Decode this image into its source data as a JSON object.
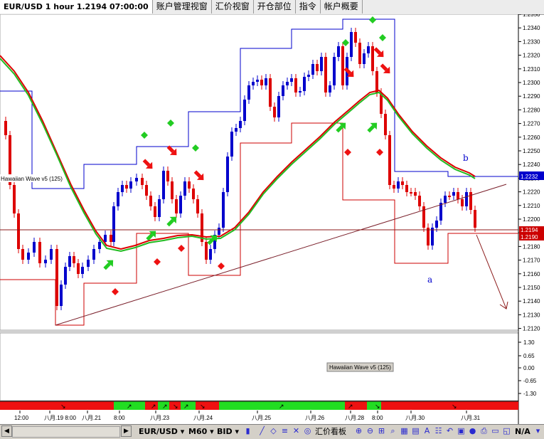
{
  "tabs": [
    {
      "label": "EUR/USD 1 hour 1.2194 07:00:00",
      "active": true
    },
    {
      "label": "账户管理视窗",
      "active": false
    },
    {
      "label": "汇价视窗",
      "active": false
    },
    {
      "label": "开仓部位",
      "active": false
    },
    {
      "label": "指令",
      "active": false
    },
    {
      "label": "帐户概要",
      "active": false
    }
  ],
  "chart": {
    "price_axis": [
      "1.2350",
      "1.2340",
      "1.2330",
      "1.2320",
      "1.2310",
      "1.2300",
      "1.2290",
      "1.2280",
      "1.2270",
      "1.2260",
      "1.2250",
      "1.2240",
      "1.2230",
      "1.2220",
      "1.2210",
      "1.2200",
      "1.2190",
      "1.2180",
      "1.2170",
      "1.2160",
      "1.2150",
      "1.2140",
      "1.2130",
      "1.2120"
    ],
    "current_price": "1.2194",
    "right_tag_upper": "1.2232",
    "right_tag_lower": "1.2190",
    "indicator_label": "Hawaiian Wave v5 (125)",
    "annotation_a": "a",
    "annotation_b": "b",
    "colors": {
      "up": "#0000cc",
      "down": "#dd0000",
      "ma_red": "#dd0000",
      "ma_green": "#22bb22",
      "band_blue": "#0000cc",
      "band_red": "#cc0000",
      "trend": "#7a1f2a"
    }
  },
  "indicator": {
    "label": "Hawaiian Wave v5 (125)",
    "axis": [
      "1.30",
      "0.65",
      "0.00",
      "-0.65",
      "-1.30"
    ]
  },
  "time_axis": [
    "12:00",
    "八月.19 8:00",
    "八月.21",
    "8:00",
    "八月.23",
    "八月.24",
    "八月.25",
    "八月.26",
    "八月.28",
    "8:00",
    "八月.30",
    "八月.31"
  ],
  "bottombar": {
    "symbol": "EUR/USD",
    "period": "M60",
    "price_type": "BID",
    "chart_label": "汇价看板",
    "na_label": "N/A"
  }
}
